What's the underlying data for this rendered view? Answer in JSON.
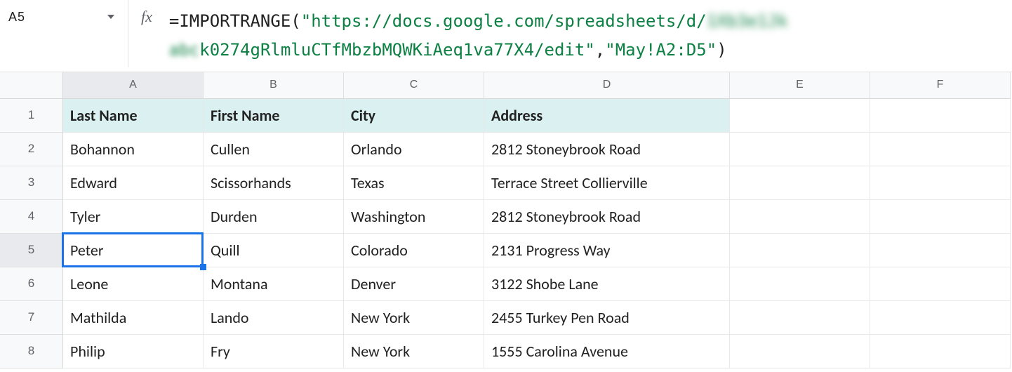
{
  "nameBox": "A5",
  "formula": {
    "prefix": "=IMPORTRANGE(",
    "quote": "\"",
    "url_start": "https://docs.google.com/spreadsheets/d/",
    "url_blur1": "1Xb3e1Jk",
    "url_blur2": "abc",
    "url_end": "k0274gRlmluCTfMbzbMQWKiAeq1va77X4/edit",
    "sep": ",",
    "range": "May!A2:D5",
    "suffix": ")"
  },
  "columns": [
    "A",
    "B",
    "C",
    "D",
    "E",
    "F"
  ],
  "rows": [
    "1",
    "2",
    "3",
    "4",
    "5",
    "6",
    "7",
    "8"
  ],
  "selectedCell": {
    "row": 5,
    "col": "A"
  },
  "headers": {
    "A": "Last Name",
    "B": "First Name",
    "C": "City",
    "D": "Address"
  },
  "data": [
    {
      "A": "Bohannon",
      "B": "Cullen",
      "C": "Orlando",
      "D": "2812 Stoneybrook Road"
    },
    {
      "A": "Edward",
      "B": "Scissorhands",
      "C": "Texas",
      "D": "Terrace Street Collierville"
    },
    {
      "A": "Tyler",
      "B": "Durden",
      "C": "Washington",
      "D": "2812 Stoneybrook Road"
    },
    {
      "A": "Peter",
      "B": "Quill",
      "C": "Colorado",
      "D": "2131 Progress Way"
    },
    {
      "A": "Leone",
      "B": "Montana",
      "C": "Denver",
      "D": "3122 Shobe Lane"
    },
    {
      "A": "Mathilda",
      "B": "Lando",
      "C": "New York",
      "D": "2455 Turkey Pen Road"
    },
    {
      "A": "Philip",
      "B": "Fry",
      "C": "New York",
      "D": "1555 Carolina Avenue"
    }
  ]
}
